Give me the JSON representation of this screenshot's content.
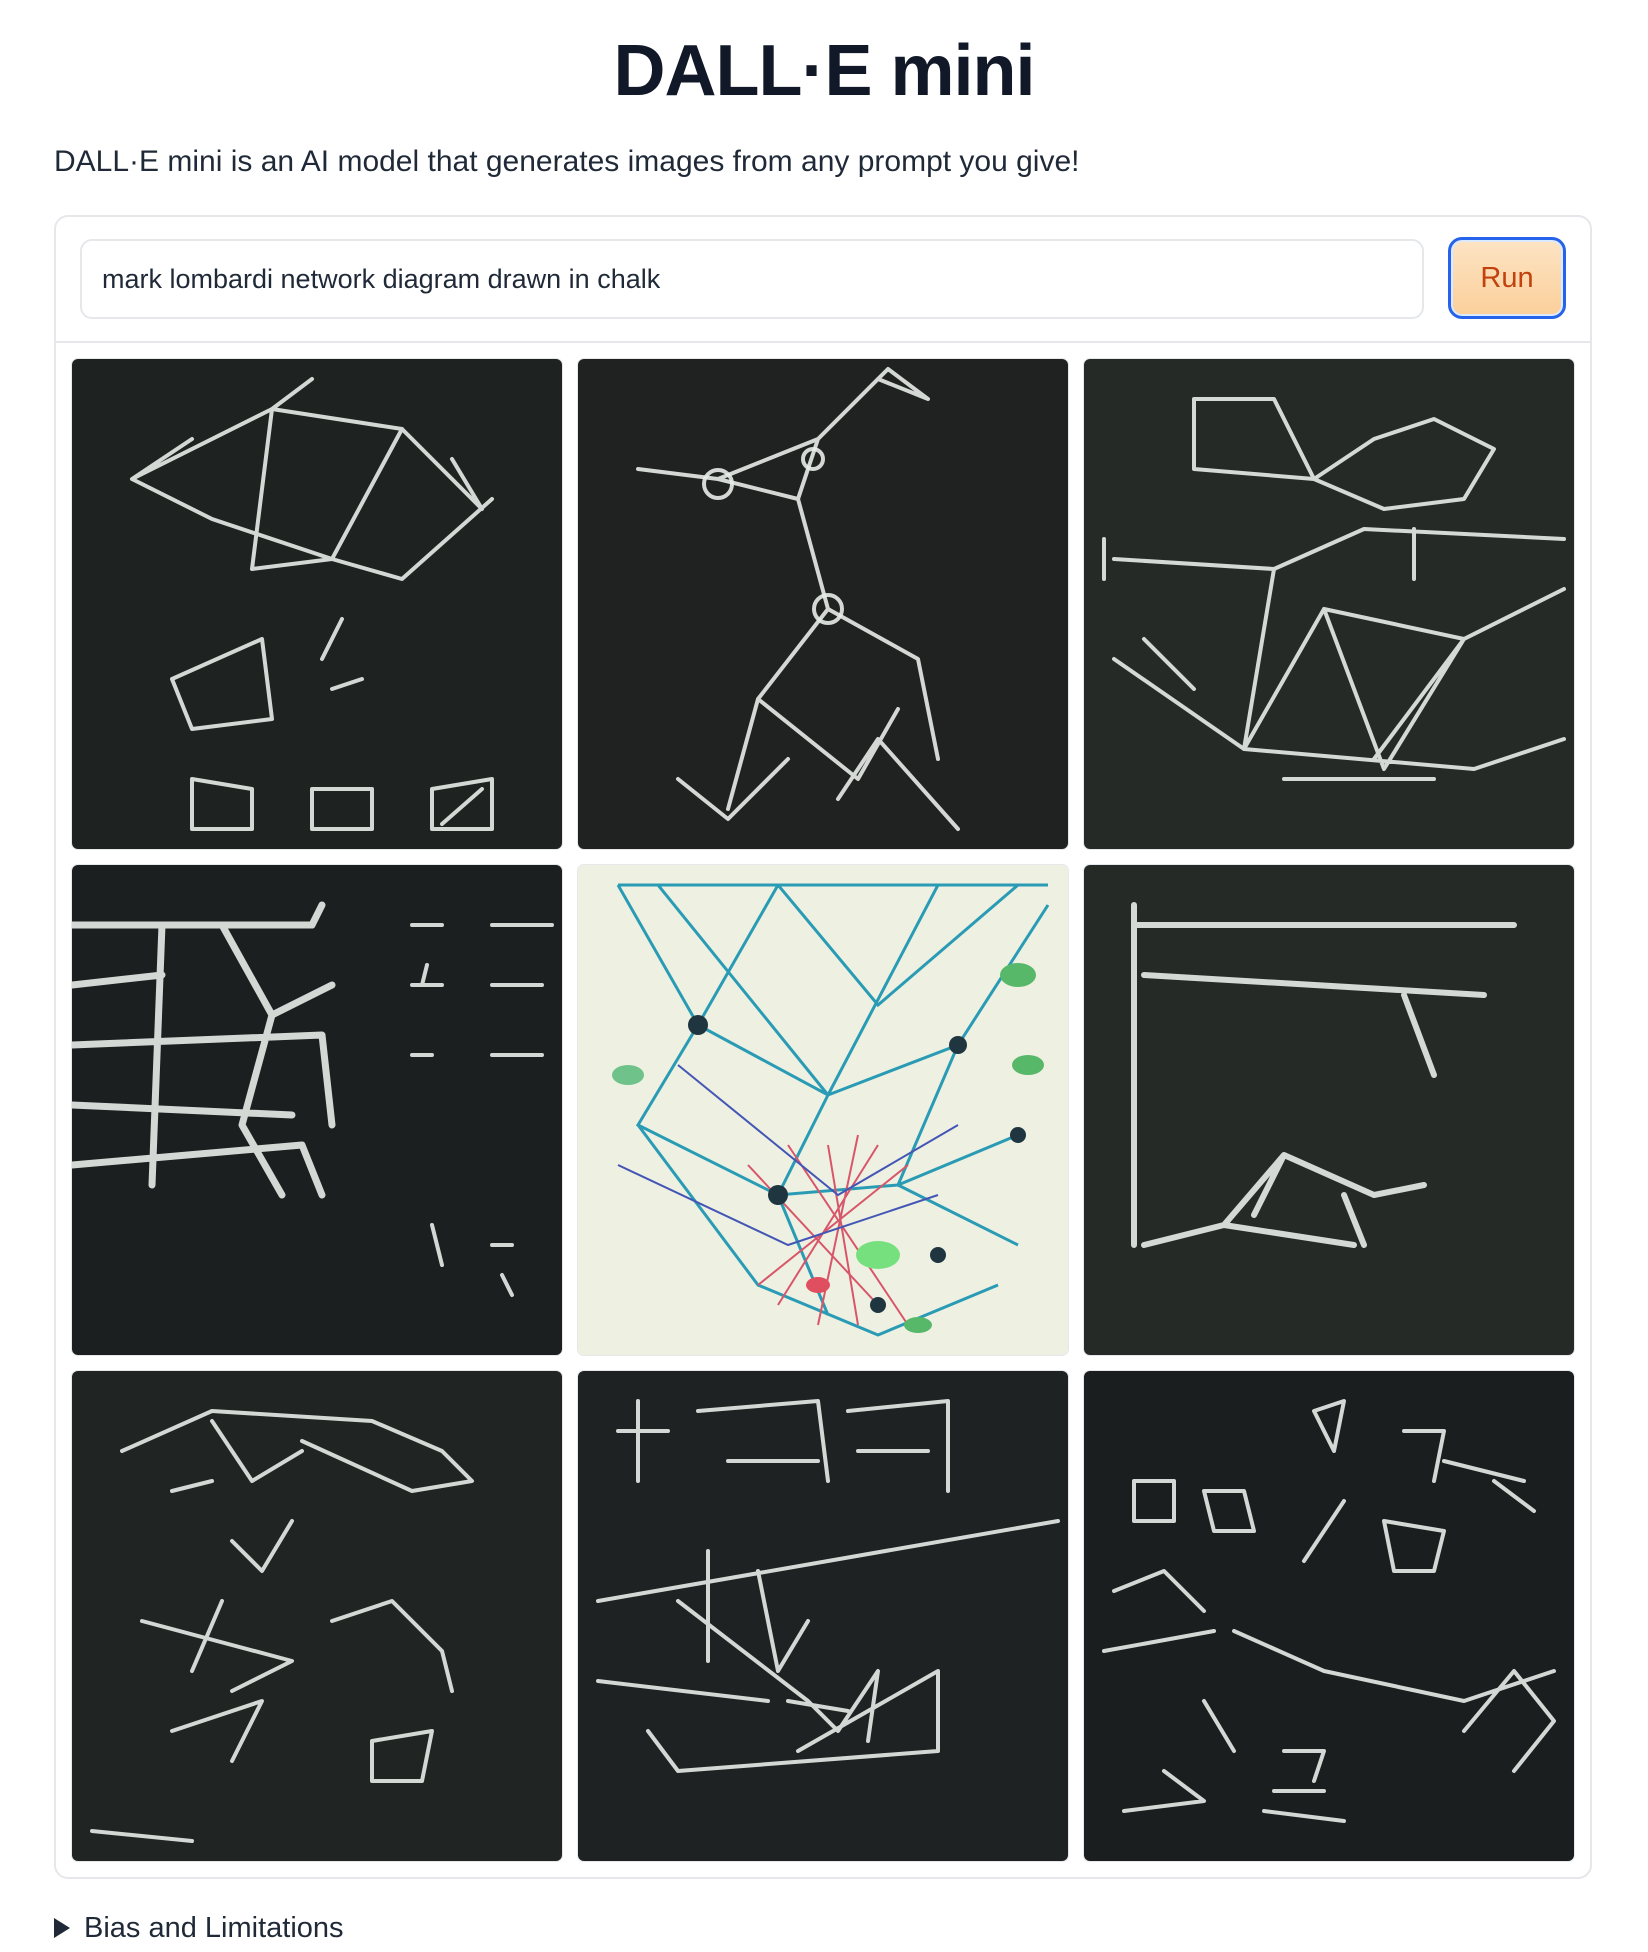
{
  "app": {
    "title": "DALL·E mini",
    "description": "DALL·E mini is an AI model that generates images from any prompt you give!"
  },
  "prompt": {
    "value": "mark lombardi network diagram drawn in chalk",
    "placeholder": ""
  },
  "run_button": {
    "label": "Run"
  },
  "gallery": {
    "images": [
      {
        "name": "generated-image-1",
        "subject": "white chalk network diagram on dark board"
      },
      {
        "name": "generated-image-2",
        "subject": "chalk nodes and lines on black board"
      },
      {
        "name": "generated-image-3",
        "subject": "dense chalk web of connected nodes"
      },
      {
        "name": "generated-image-4",
        "subject": "thick chalk grid lines on black board"
      },
      {
        "name": "generated-image-5",
        "subject": "colorful teal and red network web on light paper"
      },
      {
        "name": "generated-image-6",
        "subject": "chalk frame with triangle on dark board"
      },
      {
        "name": "generated-image-7",
        "subject": "loose chalk sketch shapes on dark board"
      },
      {
        "name": "generated-image-8",
        "subject": "chalk blocks and lines on black board"
      },
      {
        "name": "generated-image-9",
        "subject": "scattered chalk fragments on black board"
      }
    ]
  },
  "accordion": {
    "label": "Bias and Limitations",
    "icon": "triangle-right-icon"
  },
  "colors": {
    "accent_border": "#2563eb",
    "run_button_text": "#c2410c",
    "run_button_fill": "#fbcf9a",
    "chalkboard": "#1f2321"
  }
}
